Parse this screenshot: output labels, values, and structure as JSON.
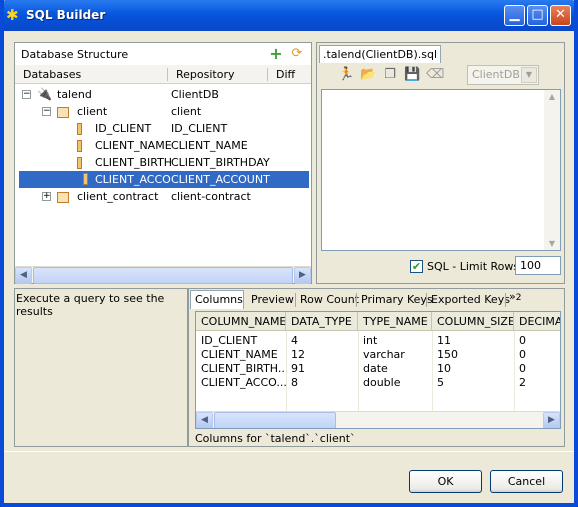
{
  "window": {
    "title": "SQL Builder"
  },
  "db_panel": {
    "title": "Database Structure",
    "columns": [
      "Databases",
      "Repository",
      "Diff"
    ],
    "rows": [
      {
        "name": "talend",
        "repo": "ClientDB"
      },
      {
        "name": "client",
        "repo": "client"
      },
      {
        "name": "ID_CLIENT",
        "repo": "ID_CLIENT"
      },
      {
        "name": "CLIENT_NAME",
        "repo": "CLIENT_NAME"
      },
      {
        "name": "CLIENT_BIRTHI",
        "repo": "CLIENT_BIRTHDAY"
      },
      {
        "name": "CLIENT_ACCOL",
        "repo": "CLIENT_ACCOUNT"
      },
      {
        "name": "client_contract",
        "repo": "client-contract"
      }
    ]
  },
  "editor": {
    "tab_label": ".talend(ClientDB).sql",
    "connection_select": "ClientDB",
    "limit_label": "SQL - Limit Rows",
    "limit_value": "100"
  },
  "results": {
    "message": "Execute a query to see the results"
  },
  "columns_panel": {
    "tabs": [
      "Columns",
      "Preview",
      "Row Count",
      "Primary Keys",
      "Exported Keys",
      "2"
    ],
    "headers": [
      "COLUMN_NAME",
      "DATA_TYPE",
      "TYPE_NAME",
      "COLUMN_SIZE",
      "DECIMA"
    ],
    "rows": [
      [
        "ID_CLIENT",
        "4",
        "int",
        "11",
        "0"
      ],
      [
        "CLIENT_NAME",
        "12",
        "varchar",
        "150",
        "0"
      ],
      [
        "CLIENT_BIRTH...",
        "91",
        "date",
        "10",
        "0"
      ],
      [
        "CLIENT_ACCO...",
        "8",
        "double",
        "5",
        "2"
      ]
    ],
    "status": "Columns for `talend`.`client`"
  },
  "buttons": {
    "ok": "OK",
    "cancel": "Cancel"
  }
}
